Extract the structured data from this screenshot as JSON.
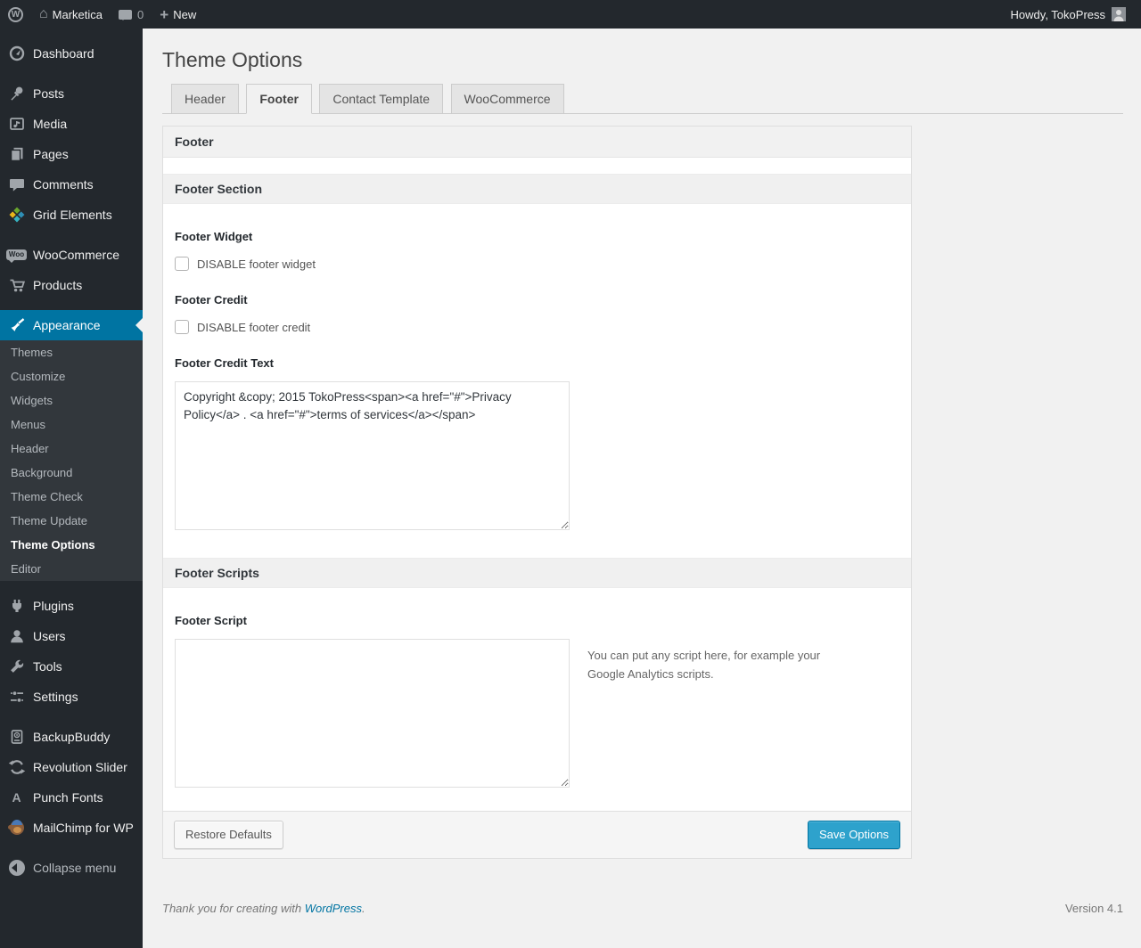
{
  "admin_bar": {
    "wp_logo_letter": "W",
    "home_glyph": "⌂",
    "site_name": "Marketica",
    "comment_count": "0",
    "plus_glyph": "+",
    "new_label": "New",
    "howdy": "Howdy, TokoPress"
  },
  "sidebar": {
    "items": [
      {
        "label": "Dashboard"
      },
      {
        "label": "Posts"
      },
      {
        "label": "Media"
      },
      {
        "label": "Pages"
      },
      {
        "label": "Comments"
      },
      {
        "label": "Grid Elements"
      },
      {
        "label": "WooCommerce",
        "badge_text": "Woo"
      },
      {
        "label": "Products"
      },
      {
        "label": "Appearance"
      },
      {
        "label": "Plugins"
      },
      {
        "label": "Users"
      },
      {
        "label": "Tools"
      },
      {
        "label": "Settings"
      },
      {
        "label": "BackupBuddy"
      },
      {
        "label": "Revolution Slider"
      },
      {
        "label": "Punch Fonts",
        "letter": "A"
      },
      {
        "label": "MailChimp for WP"
      },
      {
        "label": "Collapse menu"
      }
    ],
    "appearance_submenu": [
      "Themes",
      "Customize",
      "Widgets",
      "Menus",
      "Header",
      "Background",
      "Theme Check",
      "Theme Update",
      "Theme Options",
      "Editor"
    ],
    "active_submenu_item": "Theme Options"
  },
  "page": {
    "title": "Theme Options",
    "tabs": [
      "Header",
      "Footer",
      "Contact Template",
      "WooCommerce"
    ],
    "active_tab": "Footer"
  },
  "panel": {
    "heading": "Footer",
    "section1_title": "Footer Section",
    "footer_widget_label": "Footer Widget",
    "footer_widget_checkbox_label": "DISABLE footer widget",
    "footer_credit_label": "Footer Credit",
    "footer_credit_checkbox_label": "DISABLE footer credit",
    "footer_credit_text_label": "Footer Credit Text",
    "footer_credit_text_value": "Copyright &copy; 2015 TokoPress<span><a href=\"#\">Privacy Policy</a> . <a href=\"#\">terms of services</a></span>",
    "section2_title": "Footer Scripts",
    "footer_script_label": "Footer Script",
    "footer_script_value": "",
    "footer_script_help": "You can put any script here, for example your Google Analytics scripts.",
    "restore_button": "Restore Defaults",
    "save_button": "Save Options"
  },
  "page_footer": {
    "thanks_text": "Thank you for creating with ",
    "wordpress_link": "WordPress",
    "period": ".",
    "version": "Version 4.1"
  },
  "colors": {
    "accent": "#0074a2",
    "button_primary": "#2ea2cc",
    "admin_dark": "#23282d",
    "page_background": "#f1f1f1"
  }
}
